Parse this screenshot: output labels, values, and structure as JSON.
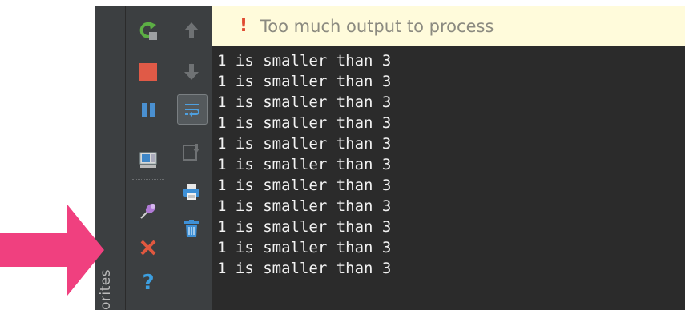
{
  "banner": {
    "icon": "!",
    "message": "Too much output to process"
  },
  "favorites_tab": {
    "label": "orites"
  },
  "console_lines": [
    "1 is smaller than 3",
    "1 is smaller than 3",
    "1 is smaller than 3",
    "1 is smaller than 3",
    "1 is smaller than 3",
    "1 is smaller than 3",
    "1 is smaller than 3",
    "1 is smaller than 3",
    "1 is smaller than 3",
    "1 is smaller than 3",
    "1 is smaller than 3"
  ],
  "toolbar_left_icons": [
    "rerun-icon",
    "stop-icon",
    "pause-icon",
    "dump-threads-icon",
    "pin-tab-icon",
    "close-icon",
    "help-icon"
  ],
  "toolbar_right_icons": [
    "up-arrow-icon",
    "down-arrow-icon",
    "soft-wrap-icon",
    "scroll-to-end-icon",
    "print-icon",
    "clear-all-icon"
  ],
  "colors": {
    "banner_bg": "#fffbdb",
    "banner_icon": "#e04b32",
    "console_bg": "#2b2b2b",
    "console_text": "#f2f2f2",
    "panel_bg": "#3c3f41",
    "annotation_arrow": "#f0407f",
    "stop_red": "#e05a47",
    "run_green": "#5cae44",
    "help_blue": "#3c9fe0"
  }
}
